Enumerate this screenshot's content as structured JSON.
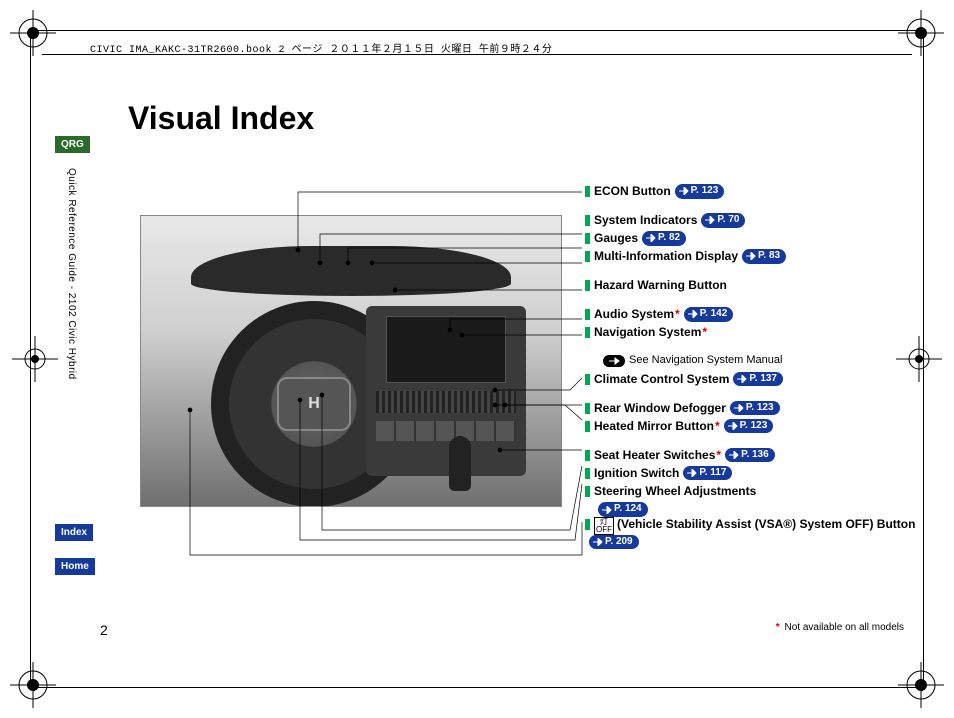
{
  "header": "CIVIC IMA_KAKC-31TR2600.book  2 ページ  ２０１１年２月１５日  火曜日  午前９時２４分",
  "title": "Visual Index",
  "tabs": {
    "qrg": "QRG",
    "index": "Index",
    "home": "Home"
  },
  "side_text": "Quick Reference Guide - 2102 Civic Hybrid",
  "page_number": "2",
  "footnote": "Not available on all models",
  "see_nav_text": "See Navigation System Manual",
  "callouts": [
    {
      "label": "ECON Button",
      "page": "P. 123"
    },
    {
      "label": "System Indicators",
      "page": "P. 70"
    },
    {
      "label": "Gauges",
      "page": "P. 82"
    },
    {
      "label": "Multi-Information Display",
      "page": "P. 83"
    },
    {
      "label": "Hazard Warning Button"
    },
    {
      "label": "Audio System",
      "star": true,
      "page": "P. 142"
    },
    {
      "label": "Navigation System",
      "star": true,
      "see_nav": true
    },
    {
      "label": "Climate Control System",
      "page": "P. 137"
    },
    {
      "label": "Rear Window Defogger",
      "page": "P. 123"
    },
    {
      "label": "Heated Mirror Button",
      "star": true,
      "page": "P. 123"
    },
    {
      "label": "Seat Heater Switches",
      "star": true,
      "page": "P. 136"
    },
    {
      "label": "Ignition Switch",
      "page": "P. 117"
    },
    {
      "label": "Steering Wheel Adjustments",
      "page": "P. 124",
      "page_below": true
    },
    {
      "label": "(Vehicle Stability Assist (VSA®) System OFF) Button",
      "page": "P. 209",
      "vsa_icon": true
    }
  ]
}
